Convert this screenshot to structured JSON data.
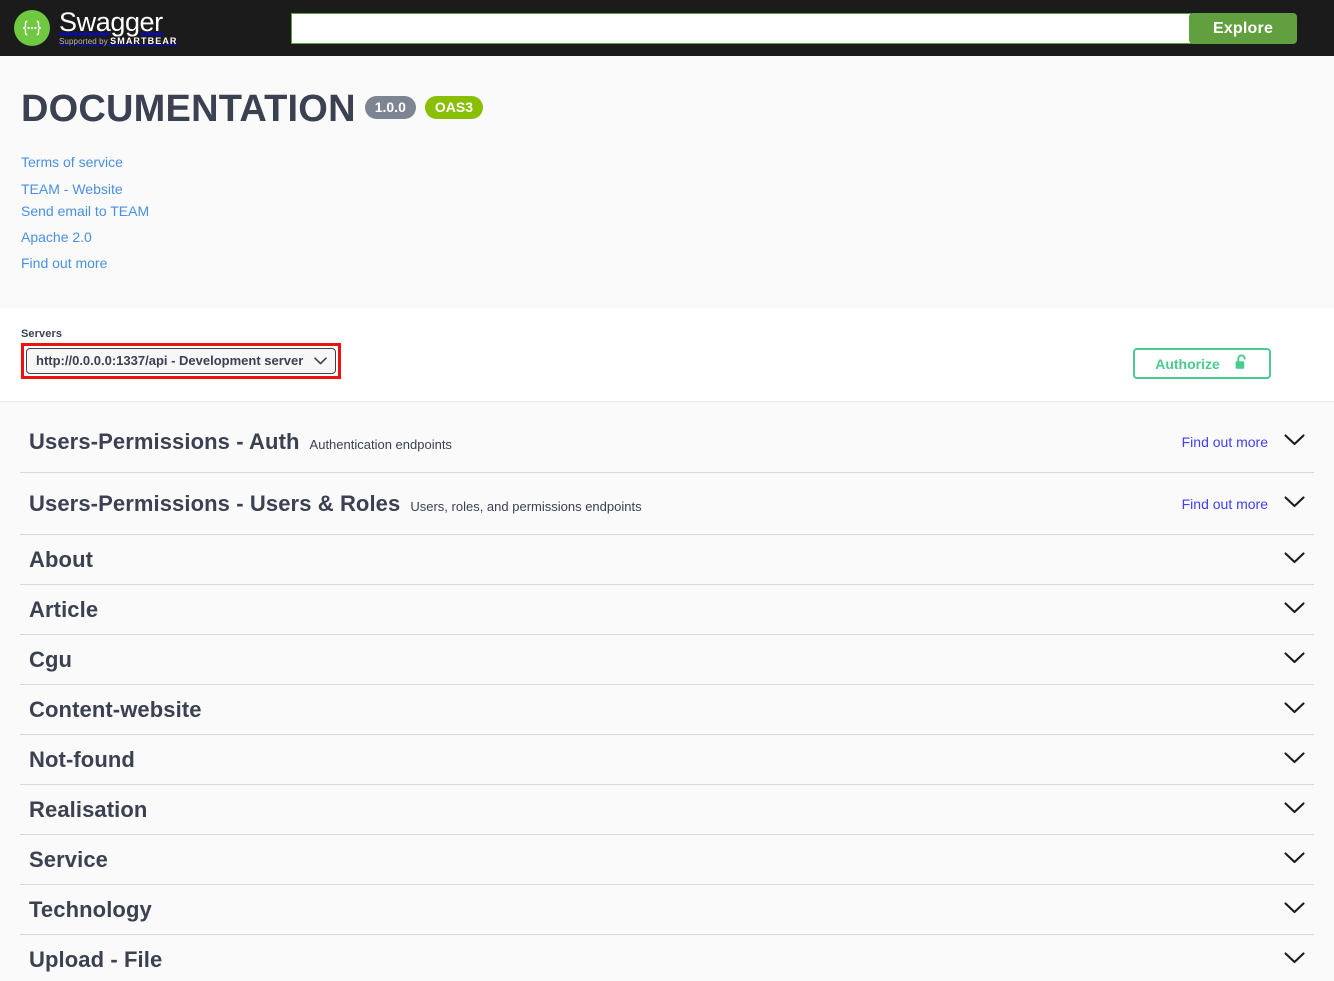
{
  "topbar": {
    "logo_alt": "Swagger",
    "wordmark": "Swagger",
    "supported_prefix": "Supported by",
    "supported_brand": "SMARTBEAR",
    "search_value": "",
    "search_placeholder": "",
    "explore_label": "Explore"
  },
  "info": {
    "title": "DOCUMENTATION",
    "version_badge": "1.0.0",
    "oas_badge": "OAS3",
    "links": [
      {
        "label": "Terms of service"
      },
      {
        "label": "TEAM - Website"
      },
      {
        "label": "Send email to TEAM"
      },
      {
        "label": "Apache 2.0"
      },
      {
        "label": "Find out more"
      }
    ]
  },
  "servers": {
    "label": "Servers",
    "selected": "http://0.0.0.0:1337/api - Development server",
    "options": [
      "http://0.0.0.0:1337/api - Development server"
    ],
    "highlight_color": "#ee1111"
  },
  "authorize": {
    "label": "Authorize",
    "icon": "unlock-icon",
    "accent_color": "#49cc90"
  },
  "tags": [
    {
      "name": "Users-Permissions - Auth",
      "description": "Authentication endpoints",
      "find_out_more": "Find out more",
      "has_link": true
    },
    {
      "name": "Users-Permissions - Users & Roles",
      "description": "Users, roles, and permissions endpoints",
      "find_out_more": "Find out more",
      "has_link": true
    },
    {
      "name": "About",
      "description": "",
      "find_out_more": "",
      "has_link": false
    },
    {
      "name": "Article",
      "description": "",
      "find_out_more": "",
      "has_link": false
    },
    {
      "name": "Cgu",
      "description": "",
      "find_out_more": "",
      "has_link": false
    },
    {
      "name": "Content-website",
      "description": "",
      "find_out_more": "",
      "has_link": false
    },
    {
      "name": "Not-found",
      "description": "",
      "find_out_more": "",
      "has_link": false
    },
    {
      "name": "Realisation",
      "description": "",
      "find_out_more": "",
      "has_link": false
    },
    {
      "name": "Service",
      "description": "",
      "find_out_more": "",
      "has_link": false
    },
    {
      "name": "Technology",
      "description": "",
      "find_out_more": "",
      "has_link": false
    },
    {
      "name": "Upload - File",
      "description": "",
      "find_out_more": "",
      "has_link": false
    }
  ]
}
